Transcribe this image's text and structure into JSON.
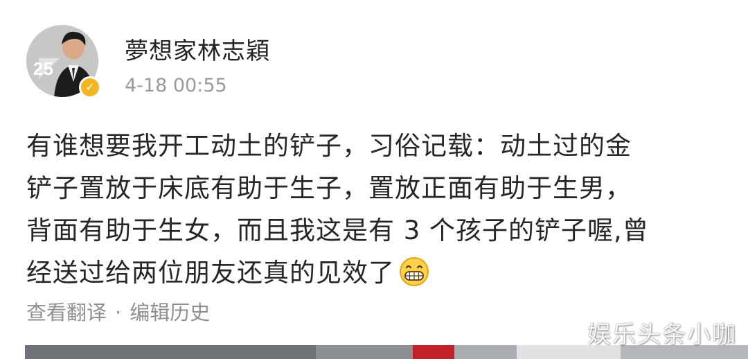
{
  "post": {
    "username": "夢想家林志穎",
    "timestamp": "4-18 00:55",
    "avatar_badge_text": "25",
    "verified_icon": "verified-badge-icon",
    "content_lines": [
      "有谁想要我开工动土的铲子，习俗记载：动土过的金",
      "铲子置放于床底有助于生子，置放正面有助于生男，",
      "背面有助于生女，而且我这是有 3 个孩子的铲子喔,曾",
      "经送过给两位朋友还真的见效了"
    ],
    "emoji_icon": "grin-emoji-icon",
    "actions": {
      "translate": "查看翻译",
      "separator": "·",
      "edit_history": "编辑历史"
    }
  },
  "watermark": "娱乐头条小咖",
  "colors": {
    "username": "#222222",
    "timestamp": "#9b9b9b",
    "body_text": "#262626",
    "action_text": "#8f8f8f",
    "verified": "#f3b622"
  }
}
